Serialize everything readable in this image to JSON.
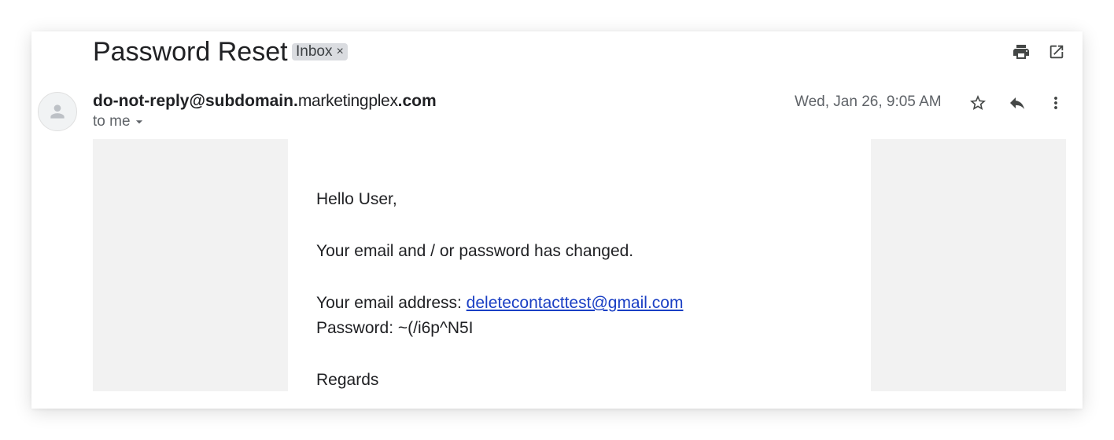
{
  "message": {
    "subject": "Password Reset",
    "label": "Inbox",
    "label_remove": "×",
    "sender": {
      "part1": "do-not-reply@subdomain.",
      "part2": "marketingplex",
      "part3": ".",
      "part4": "com"
    },
    "recipient_label": "to me",
    "date": "Wed, Jan 26, 9:05 AM"
  },
  "toolbar": {
    "icons": [
      "print-icon",
      "open-in-new-window-icon",
      "star-icon",
      "reply-icon",
      "more-vert-icon"
    ]
  },
  "email_body": {
    "greeting": "Hello User,",
    "notice": "Your email and / or password has changed.",
    "email_label": "Your email address: ",
    "email_link": "deletecontacttest@gmail.com",
    "password_line": "Password: ~(/i6p^N5I",
    "closing": "Regards"
  },
  "colors": {
    "link": "#1a3fc4",
    "chip_bg": "#dadce0",
    "panel_gray": "#f2f2f2",
    "text_primary": "#202124",
    "text_secondary": "#5f6368"
  }
}
